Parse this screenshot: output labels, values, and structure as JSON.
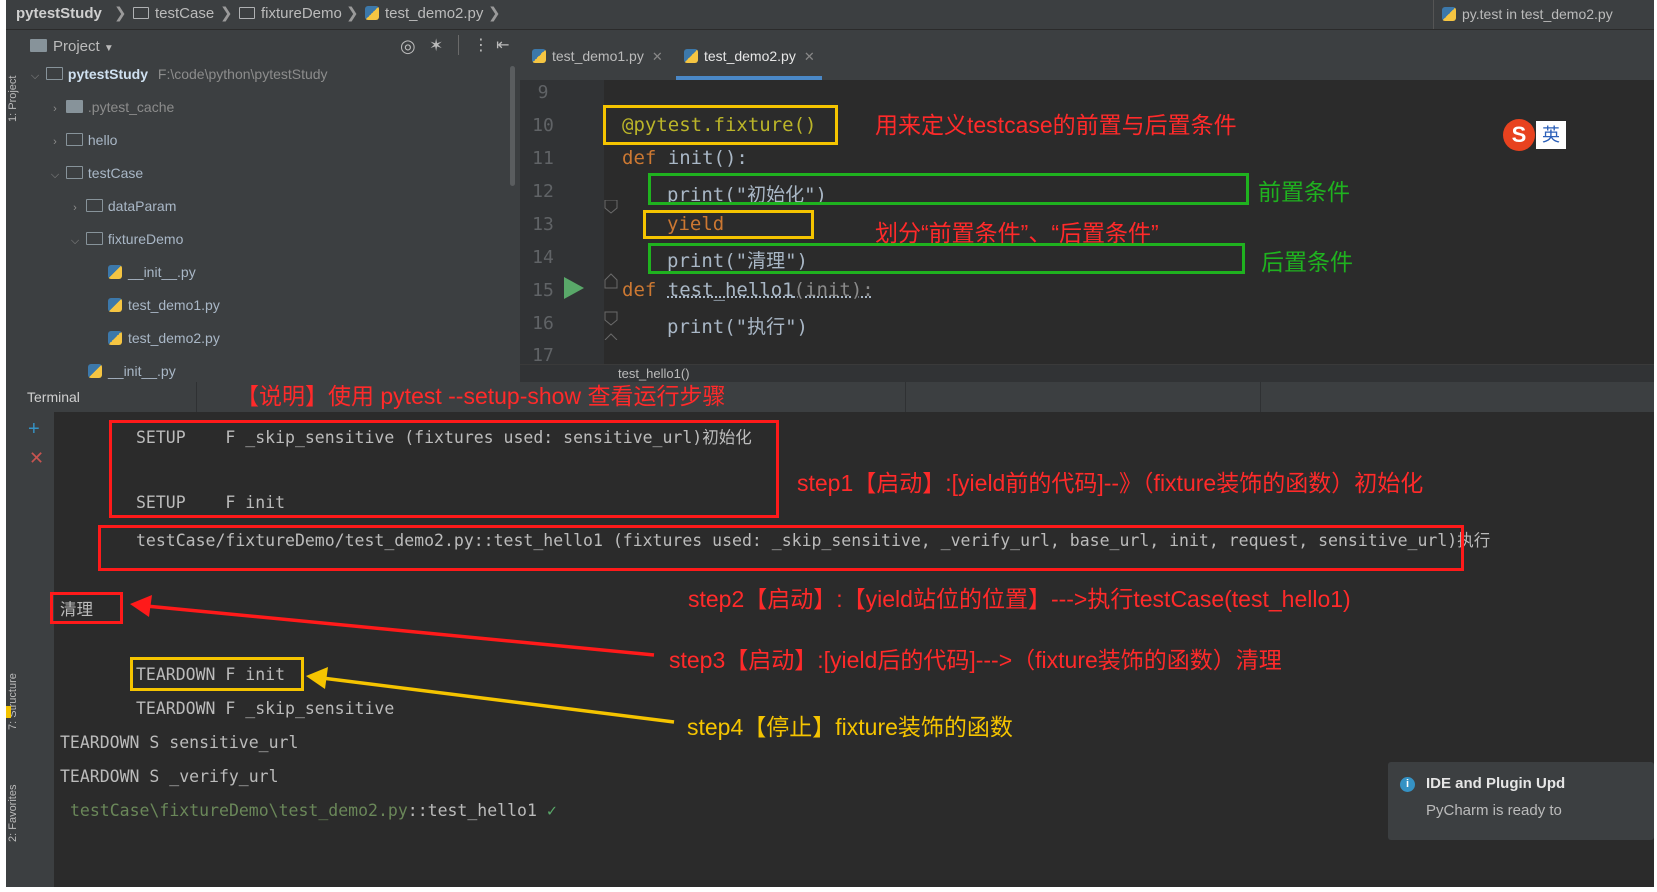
{
  "breadcrumb": {
    "items": [
      "pytestStudy",
      "testCase",
      "fixtureDemo",
      "test_demo2.py"
    ],
    "run_config": "py.test in test_demo2.py"
  },
  "side_labels": {
    "project": "1: Project",
    "structure": "7: Structure",
    "favorites": "2: Favorites"
  },
  "project": {
    "title": "Project",
    "root": {
      "name": "pytestStudy",
      "path": "F:\\code\\python\\pytestStudy"
    },
    "tree": [
      {
        "label": ".pytest_cache",
        "depth": 1,
        "type": "folder",
        "expanded": false
      },
      {
        "label": "hello",
        "depth": 1,
        "type": "package",
        "expanded": false
      },
      {
        "label": "testCase",
        "depth": 1,
        "type": "package",
        "expanded": true
      },
      {
        "label": "dataParam",
        "depth": 2,
        "type": "package",
        "expanded": false
      },
      {
        "label": "fixtureDemo",
        "depth": 2,
        "type": "package",
        "expanded": true
      },
      {
        "label": "__init__.py",
        "depth": 3,
        "type": "python"
      },
      {
        "label": "test_demo1.py",
        "depth": 3,
        "type": "python"
      },
      {
        "label": "test_demo2.py",
        "depth": 3,
        "type": "python"
      },
      {
        "label": "__init__.py",
        "depth": 2,
        "type": "python"
      }
    ]
  },
  "editor": {
    "tabs": [
      {
        "label": "test_demo1.py",
        "active": false
      },
      {
        "label": "test_demo2.py",
        "active": true
      }
    ],
    "line_numbers": [
      "9",
      "10",
      "11",
      "12",
      "13",
      "14",
      "15",
      "16",
      "17"
    ],
    "code": {
      "l10": "@pytest.fixture()",
      "l11_kw": "def",
      "l11_fn": "init():",
      "l12": "print(\"初始化\")",
      "l13": "yield",
      "l14": "print(\"清理\")",
      "l15_kw": "def",
      "l15_fn": "test_hello1",
      "l15_args": "(init):",
      "l16": "print(\"执行\")"
    },
    "crumb": "test_hello1()"
  },
  "terminal": {
    "title": "Terminal",
    "lines": {
      "setup1": "SETUP    F _skip_sensitive (fixtures used: sensitive_url)初始化",
      "setup2": "SETUP    F init",
      "test_line": "testCase/fixtureDemo/test_demo2.py::test_hello1 (fixtures used: _skip_sensitive, _verify_url, base_url, init, request, sensitive_url)执行",
      "cleanup": "清理",
      "td1": "TEARDOWN F init",
      "td2": "TEARDOWN F _skip_sensitive",
      "td3": "TEARDOWN S sensitive_url",
      "td4": "TEARDOWN S _verify_url",
      "result_path": "testCase\\fixtureDemo\\test_demo2.py",
      "result_test": "::test_hello1",
      "result_mark": "✓"
    }
  },
  "annotations": {
    "fixture_note": "用来定义testcase的前置与后置条件",
    "pre_condition": "前置条件",
    "yield_note": "划分“前置条件”、“后置条件”",
    "post_condition": "后置条件",
    "explanation": "【说明】使用 pytest --setup-show 查看运行步骤",
    "step1": "step1【启动】:[yield前的代码]--》（fixture装饰的函数）初始化",
    "step2": "step2【启动】:【yield站位的位置】--->执行testCase(test_hello1)",
    "step3": "step3【启动】:[yield后的代码]--->（fixture装饰的函数）清理",
    "step4": "step4【停止】fixture装饰的函数"
  },
  "notification": {
    "title": "IDE and Plugin Upd",
    "body": "PyCharm is ready to"
  },
  "ime": {
    "label": "英"
  },
  "colors": {
    "red_annotation": "#ff2a2a",
    "green_annotation": "#1fb21f",
    "yellow_box": "#f5c400",
    "editor_bg": "#2b2b2b",
    "panel_bg": "#3c3f41"
  }
}
